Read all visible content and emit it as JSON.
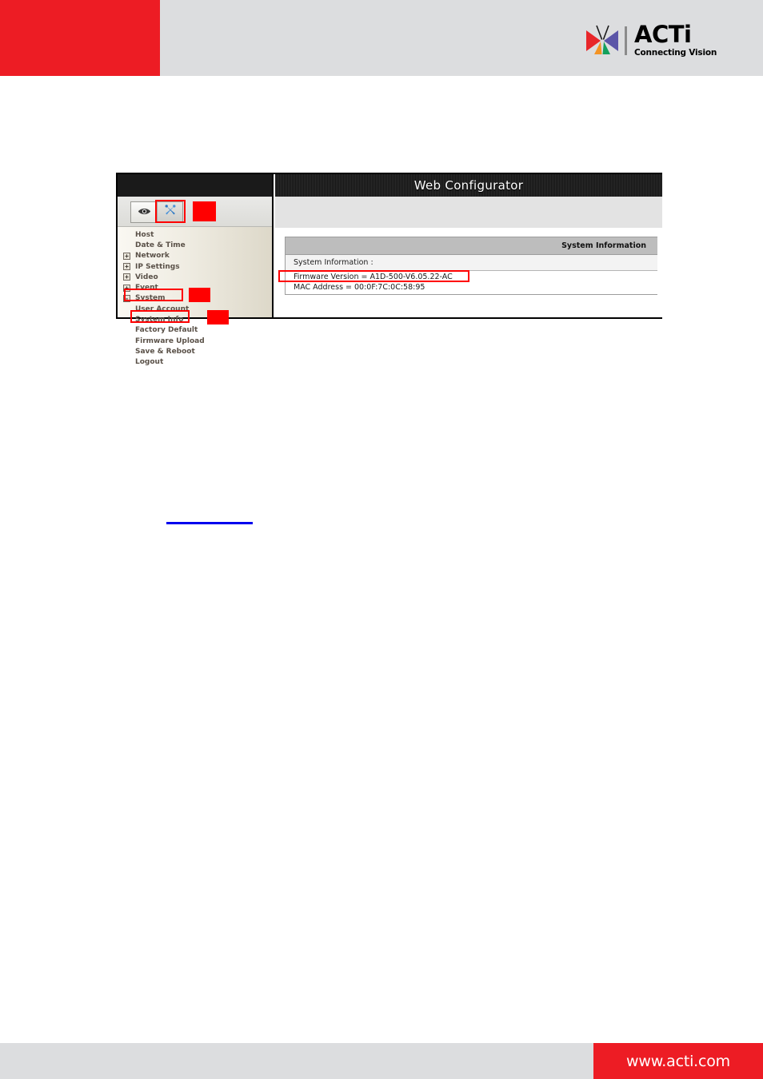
{
  "header": {
    "brand_name": "ACTi",
    "brand_tagline": "Connecting Vision",
    "logo_icon": "acti-butterfly-logo",
    "accent_red": "#ed1c24",
    "band_gray": "#dcdddf"
  },
  "figure": {
    "toolbar": {
      "buttons": [
        {
          "icon": "eye-icon",
          "name": "live-view-button",
          "active": false
        },
        {
          "icon": "tools-icon",
          "name": "setup-tools-button",
          "active": true
        }
      ]
    },
    "sidebar": {
      "items": [
        {
          "label": "Host",
          "expander": "",
          "sub": false
        },
        {
          "label": "Date & Time",
          "expander": "",
          "sub": false
        },
        {
          "label": "Network",
          "expander": "+",
          "sub": false
        },
        {
          "label": "IP Settings",
          "expander": "+",
          "sub": false
        },
        {
          "label": "Video",
          "expander": "+",
          "sub": false
        },
        {
          "label": "Event",
          "expander": "+",
          "sub": false
        },
        {
          "label": "System",
          "expander": "-",
          "sub": false
        },
        {
          "label": "User Account",
          "expander": "",
          "sub": true
        },
        {
          "label": "System Info",
          "expander": "",
          "sub": true
        },
        {
          "label": "Factory Default",
          "expander": "",
          "sub": true
        },
        {
          "label": "Firmware Upload",
          "expander": "",
          "sub": true
        },
        {
          "label": "Save & Reboot",
          "expander": "",
          "sub": true
        },
        {
          "label": "Logout",
          "expander": "",
          "sub": true
        }
      ]
    },
    "content": {
      "title": "Web Configurator",
      "table_header": "System Information",
      "section_label": "System Information :",
      "firmware_line": "Firmware Version = A1D-500-V6.05.22-AC",
      "mac_line": "MAC Address = 00:0F:7C:0C:58:95"
    },
    "annotations": {
      "highlight_color": "#ff0000",
      "outlined": [
        "setup-tools-button",
        "System",
        "System Info",
        "Firmware Version = A1D-500-V6.05.22-AC"
      ],
      "markers": 3
    }
  },
  "footer": {
    "url": "www.acti.com",
    "red": "#ed1c24",
    "bar_gray": "#dcdddf"
  }
}
